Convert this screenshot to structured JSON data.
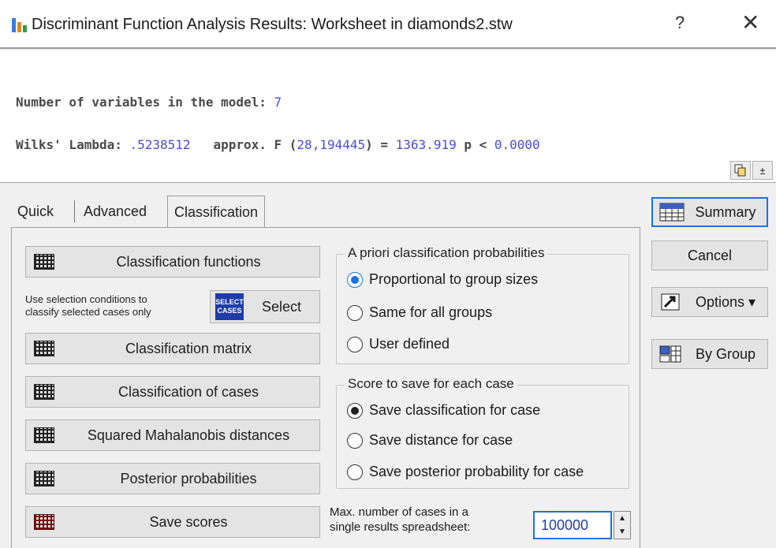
{
  "window": {
    "title": "Discriminant Function Analysis Results: Worksheet in diamonds2.stw",
    "help_glyph": "?",
    "close_glyph": "✕"
  },
  "output": {
    "line1_label": "Number of variables in the model: ",
    "line1_value": "7",
    "wilks_label": "Wilks' Lambda: ",
    "wilks_value": ".5238512",
    "f_label": "   approx. F (",
    "f_df": "28,194445",
    "f_eq": ") = ",
    "f_value": "1363.919",
    "p_label": " p < ",
    "p_value": "0.0000"
  },
  "toolbar": {
    "copy_icon": "copy-icon",
    "expand_glyph": "±"
  },
  "tabs": [
    {
      "label": "Quick"
    },
    {
      "label": "Advanced"
    },
    {
      "label": "Classification"
    }
  ],
  "left_buttons": {
    "classification_functions": "Classification functions",
    "select_note": "Use selection conditions to\nclassify selected cases only",
    "select_icon_text": "SELECT\nCASES",
    "select": "Select",
    "classification_matrix": "Classification matrix",
    "classification_of_cases": "Classification of cases",
    "mahalanobis": "Squared Mahalanobis distances",
    "posterior": "Posterior probabilities",
    "save_scores": "Save scores"
  },
  "priors": {
    "title": "A priori classification probabilities",
    "options": [
      "Proportional to group sizes",
      "Same for all groups",
      "User defined"
    ],
    "selected": 0
  },
  "score": {
    "title": "Score to save for each case",
    "options": [
      "Save classification for case",
      "Save distance for case",
      "Save posterior probability for case"
    ],
    "selected": 0
  },
  "max_cases": {
    "label": "Max. number of cases in a\nsingle results spreadsheet:",
    "value": "100000"
  },
  "right_buttons": {
    "summary": "Summary",
    "cancel": "Cancel",
    "options": "Options ▾",
    "by_group": "By Group"
  },
  "colors": {
    "accent": "#1a73e8",
    "number": "#4b4bd6"
  }
}
